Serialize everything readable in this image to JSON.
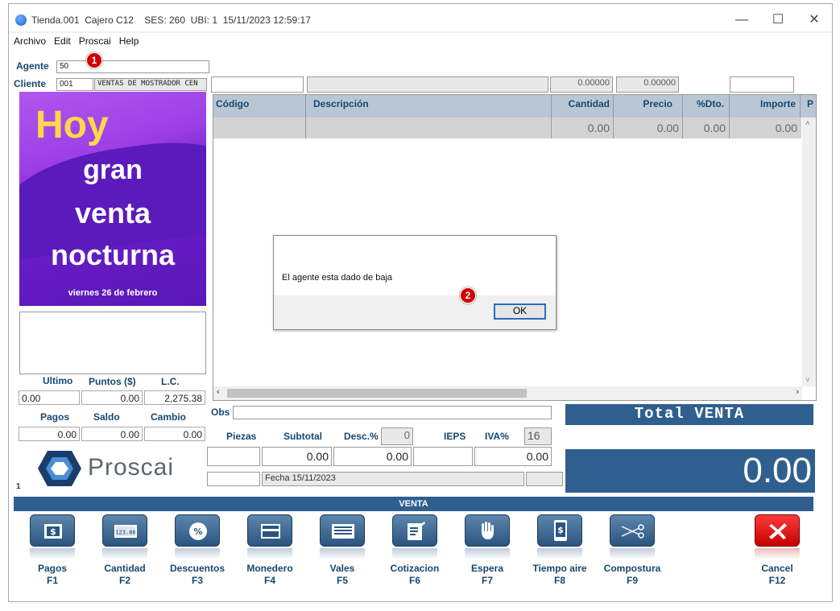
{
  "window": {
    "title": "Tienda.001  Cajero C12    SES: 260  UBI: 1  15/11/2023 12:59:17",
    "minimize": "—",
    "maximize": "☐",
    "close": "✕"
  },
  "menu": [
    "Archivo",
    "Edit",
    "Proscai",
    "Help"
  ],
  "header": {
    "agente_label": "Agente",
    "agente_value": "50",
    "cliente_label": "Cliente",
    "cliente_code": "001",
    "cliente_name": "VENTAS DE MOSTRADOR CEN",
    "field_a": "0.00000",
    "field_b": "0.00000"
  },
  "badges": {
    "one": "1",
    "two": "2"
  },
  "promo": {
    "hoy": "Hoy",
    "line1": "gran",
    "line2": "venta",
    "line3": "nocturna",
    "date": "viernes 26 de febrero"
  },
  "stats": {
    "ultimo_label": "Ultimo",
    "puntos_label": "Puntos ($)",
    "lc_label": "L.C.",
    "ultimo": "0.00",
    "puntos": "0.00",
    "lc": "2,275.38",
    "pagos_label": "Pagos",
    "saldo_label": "Saldo",
    "cambio_label": "Cambio",
    "pagos": "0.00",
    "saldo": "0.00",
    "cambio": "0.00"
  },
  "logo": {
    "text": "Proscai",
    "counter": "1"
  },
  "grid": {
    "columns": [
      "Código",
      "Descripción",
      "Cantidad",
      "Precio",
      "%Dto.",
      "Importe",
      "P"
    ],
    "row": {
      "cantidad": "0.00",
      "precio": "0.00",
      "dto": "0.00",
      "importe": "0.00"
    }
  },
  "dialog": {
    "message": "El agente esta dado de baja",
    "ok": "OK"
  },
  "summary": {
    "obs_label": "Obs",
    "piezas_label": "Piezas",
    "subtotal_label": "Subtotal",
    "desc_label": "Desc.%",
    "desc_value": "0",
    "ieps_label": "IEPS",
    "iva_label": "IVA%",
    "iva_value": "16",
    "subtotal": "0.00",
    "desc": "0.00",
    "iva": "0.00",
    "fecha": "Fecha 15/11/2023"
  },
  "total": {
    "label": "Total VENTA",
    "value": "0.00"
  },
  "venta_bar": "VENTA",
  "fkeys": [
    {
      "name": "Pagos",
      "key": "F1"
    },
    {
      "name": "Cantidad",
      "key": "F2"
    },
    {
      "name": "Descuentos",
      "key": "F3"
    },
    {
      "name": "Monedero",
      "key": "F4"
    },
    {
      "name": "Vales",
      "key": "F5"
    },
    {
      "name": "Cotizacion",
      "key": "F6"
    },
    {
      "name": "Espera",
      "key": "F7"
    },
    {
      "name": "Tiempo aire",
      "key": "F8"
    },
    {
      "name": "Compostura",
      "key": "F9"
    },
    {
      "name": "Cancel",
      "key": "F12"
    }
  ],
  "icon_text": {
    "cantidad_digits": "123.86"
  }
}
